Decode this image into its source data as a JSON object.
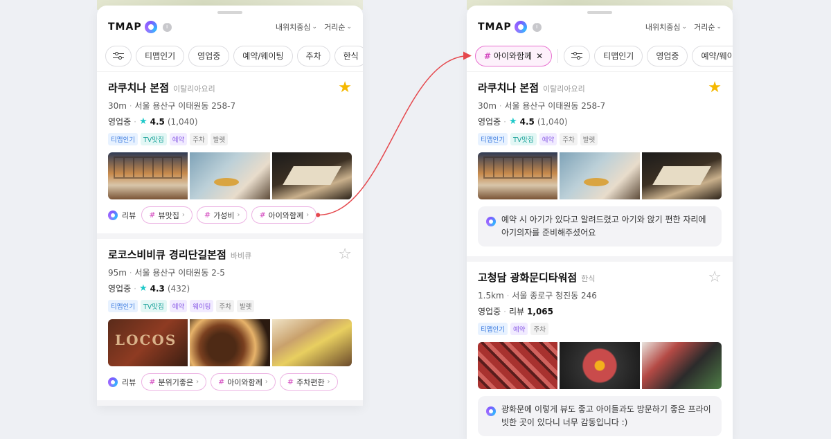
{
  "app": {
    "logo_text": "TMAP",
    "info_icon": "info-icon",
    "sort_options": [
      "내위치중심",
      "거리순"
    ]
  },
  "left": {
    "chips": [
      "티맵인기",
      "영업중",
      "예약/웨이팅",
      "주차",
      "한식"
    ],
    "cards": [
      {
        "name": "라쿠치나 본점",
        "category": "이탈리아요리",
        "distance": "30m",
        "address": "서울 용산구 이태원동 258-7",
        "status": "영업중",
        "rating": "4.5",
        "count": "(1,040)",
        "tags": [
          "티맵인기",
          "TV맛집",
          "예약",
          "주차",
          "발렛"
        ],
        "favorite": true,
        "review_label": "리뷰",
        "keywords": [
          "뷰맛집",
          "가성비",
          "아이와함께"
        ]
      },
      {
        "name": "로코스비비큐 경리단길본점",
        "category": "바비큐",
        "distance": "95m",
        "address": "서울 용산구 이태원동 2-5",
        "status": "영업중",
        "rating": "4.3",
        "count": "(432)",
        "tags": [
          "티맵인기",
          "TV맛집",
          "예약",
          "웨이팅",
          "주차",
          "발렛"
        ],
        "favorite": false,
        "review_label": "리뷰",
        "keywords": [
          "분위기좋은",
          "아이와함께",
          "주차편한"
        ]
      }
    ]
  },
  "right": {
    "active_chip": "아이와함께",
    "chips": [
      "티맵인기",
      "영업중",
      "예약/웨이팅"
    ],
    "cards": [
      {
        "name": "라쿠치나 본점",
        "category": "이탈리아요리",
        "distance": "30m",
        "address": "서울 용산구 이태원동 258-7",
        "status": "영업중",
        "rating": "4.5",
        "count": "(1,040)",
        "tags": [
          "티맵인기",
          "TV맛집",
          "예약",
          "주차",
          "발렛"
        ],
        "favorite": true,
        "review": "예약 시 아기가 있다고 알려드렸고 아기와 앉기 편한 자리에 아기의자를 준비해주셨어요"
      },
      {
        "name": "고청담 광화문디타워점",
        "category": "한식",
        "distance": "1.5km",
        "address": "서울 종로구 청진동 246",
        "status": "영업중",
        "review_count_label": "리뷰",
        "review_count": "1,065",
        "tags": [
          "티맵인기",
          "예약",
          "주차"
        ],
        "favorite": false,
        "review": "광화문에 이렇게 뷰도 좋고 아이들과도 방문하기 좋은 프라이빗한 곳이 있다니 너무 감동입니다 :)"
      }
    ]
  },
  "colors": {
    "accent_pink": "#e86fd0",
    "star_gold": "#f5b800",
    "rating_teal": "#1ec8c8",
    "arrow_red": "#e5484d"
  }
}
